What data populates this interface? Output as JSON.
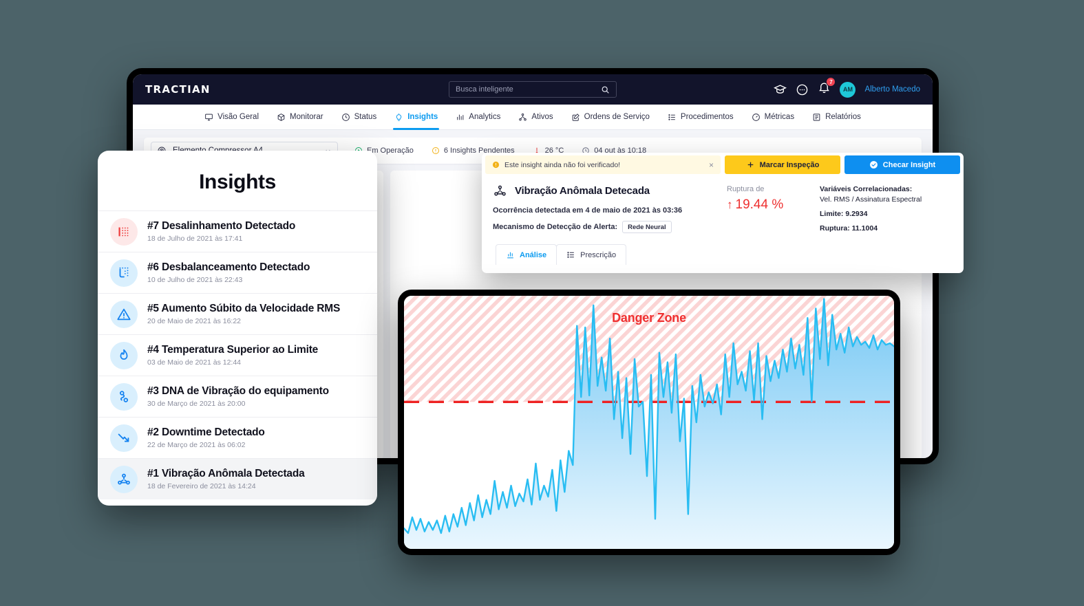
{
  "topbar": {
    "logo": "TRACTIAN",
    "search_placeholder": "Busca inteligente",
    "search_value": "",
    "notifications_count": "7",
    "avatar_initials": "AM",
    "user_name": "Alberto Macedo"
  },
  "nav": {
    "items": [
      {
        "label": "Visão Geral",
        "icon": "monitor-icon",
        "active": false
      },
      {
        "label": "Monitorar",
        "icon": "box-icon",
        "active": false
      },
      {
        "label": "Status",
        "icon": "clock-icon",
        "active": false
      },
      {
        "label": "Insights",
        "icon": "bulb-icon",
        "active": true
      },
      {
        "label": "Analytics",
        "icon": "bars-icon",
        "active": false
      },
      {
        "label": "Ativos",
        "icon": "hierarchy-icon",
        "active": false
      },
      {
        "label": "Ordens de Serviço",
        "icon": "edit-doc-icon",
        "active": false
      },
      {
        "label": "Procedimentos",
        "icon": "list-icon",
        "active": false
      },
      {
        "label": "Métricas",
        "icon": "gauge-icon",
        "active": false
      },
      {
        "label": "Relatórios",
        "icon": "report-icon",
        "active": false
      }
    ]
  },
  "subheader": {
    "asset_name": "Elemento Compressor A4",
    "statuses": [
      {
        "label": "Em Operação",
        "icon": "play-circle-icon",
        "color": "#17b26a"
      },
      {
        "label": "6 Insights Pendentes",
        "icon": "alert-circle-icon",
        "color": "#f2b21a"
      },
      {
        "label": "26 °C",
        "icon": "thermometer-icon",
        "color": "#ea3b3b"
      },
      {
        "label": "04 out às 10:18",
        "icon": "clock-icon",
        "color": "#6a6d84"
      }
    ]
  },
  "insights_panel": {
    "title": "Insights",
    "items": [
      {
        "title": "#7 Desalinhamento Detectado",
        "date": "18 de Julho de 2021 às 17:41",
        "icon": "alignment-dots-icon",
        "tone": "red",
        "selected": false
      },
      {
        "title": "#6 Desbalanceamento Detectado",
        "date": "10 de Julho de 2021 às 22:43",
        "icon": "balance-dashed-icon",
        "tone": "blue",
        "selected": false
      },
      {
        "title": "#5 Aumento Súbito da Velocidade RMS",
        "date": "20 de Maio de 2021 às 16:22",
        "icon": "warning-triangle-icon",
        "tone": "blue",
        "selected": false
      },
      {
        "title": "#4 Temperatura Superior ao Limite",
        "date": "03 de Maio de 2021 às 12:44",
        "icon": "flame-icon",
        "tone": "blue",
        "selected": false
      },
      {
        "title": "#3 DNA de Vibração do equipamento",
        "date": "30 de Março de 2021 às 20:00",
        "icon": "dna-chain-icon",
        "tone": "blue",
        "selected": false
      },
      {
        "title": "#2 Downtime Detectado",
        "date": "22 de Março de 2021 às 06:02",
        "icon": "arrow-down-trend-icon",
        "tone": "blue",
        "selected": false
      },
      {
        "title": "#1 Vibração Anômala Detectada",
        "date": "18 de Fevereiro de 2021 às 14:24",
        "icon": "molecule-icon",
        "tone": "blue",
        "selected": true
      }
    ]
  },
  "detail_card": {
    "warning_text": "Este insight ainda não foi verificado!",
    "close_label": "×",
    "btn_inspect": "Marcar Inspeção",
    "btn_check": "Checar Insight",
    "title": "Vibração Anômala Detecada",
    "occurrence": "Ocorrência detectada em 4 de maio de 2021 às 03:36",
    "mechanism_label": "Mecanismo de Detecção de Alerta:",
    "mechanism_value": "Rede Neural",
    "rupture_label": "Ruptura de",
    "rupture_arrow": "↑",
    "rupture_value": "19.44 %",
    "correlated_head": "Variáveis Correlacionadas:",
    "correlated_sub": "Vel. RMS / Assinatura Espectral",
    "limit_row": "Limite: 9.2934",
    "rupture_row": "Ruptura: 11.1004",
    "tabs": [
      {
        "label": "Análise",
        "icon": "chart-icon",
        "active": true
      },
      {
        "label": "Prescrição",
        "icon": "list-icon",
        "active": false
      }
    ]
  },
  "chart_data": {
    "type": "area",
    "title": "",
    "annotations": [
      {
        "text": "Danger Zone",
        "color": "#f03030"
      }
    ],
    "threshold": {
      "label": "Limite",
      "value": 9.2934,
      "color": "#ee2222",
      "style": "dashed"
    },
    "series_name": "Vel. RMS",
    "line_color": "#29bdf2",
    "fill_top_color": "#78c9f4",
    "fill_bottom_color": "#e7f5fd",
    "danger_zone_color": "#fbd6d6",
    "ylim": [
      0,
      16
    ],
    "xlabel": "",
    "ylabel": "",
    "grid": false,
    "values": [
      1.3,
      1.0,
      2.0,
      1.2,
      1.9,
      1.1,
      1.7,
      1.2,
      1.8,
      1.0,
      2.1,
      1.1,
      2.2,
      1.4,
      2.6,
      1.5,
      2.9,
      1.8,
      3.4,
      2.0,
      3.1,
      2.2,
      4.3,
      2.5,
      3.6,
      2.6,
      4.0,
      2.7,
      3.5,
      3.0,
      4.4,
      2.8,
      5.4,
      3.1,
      4.0,
      3.3,
      5.0,
      2.4,
      5.6,
      3.6,
      6.2,
      5.3,
      14.1,
      9.6,
      14.0,
      9.7,
      15.4,
      10.3,
      12.1,
      10.0,
      13.3,
      8.2,
      11.2,
      7.0,
      10.8,
      6.0,
      12.0,
      9.0,
      9.3,
      4.6,
      11.0,
      1.9,
      12.4,
      9.6,
      11.8,
      8.6,
      12.3,
      6.8,
      9.5,
      2.2,
      10.3,
      8.0,
      11.0,
      9.0,
      9.9,
      9.2,
      10.4,
      8.5,
      12.3,
      9.6,
      13.0,
      10.4,
      11.2,
      10.0,
      12.5,
      9.4,
      13.0,
      8.2,
      12.2,
      10.6,
      11.9,
      10.8,
      12.6,
      11.2,
      13.3,
      11.4,
      12.9,
      11.0,
      14.6,
      9.3,
      15.2,
      12.0,
      15.8,
      11.6,
      14.8,
      12.6,
      13.6,
      12.4,
      14.0,
      12.8,
      13.4,
      12.9,
      13.1,
      12.7,
      13.5,
      12.6,
      13.2,
      12.9,
      13.0,
      12.8
    ]
  }
}
